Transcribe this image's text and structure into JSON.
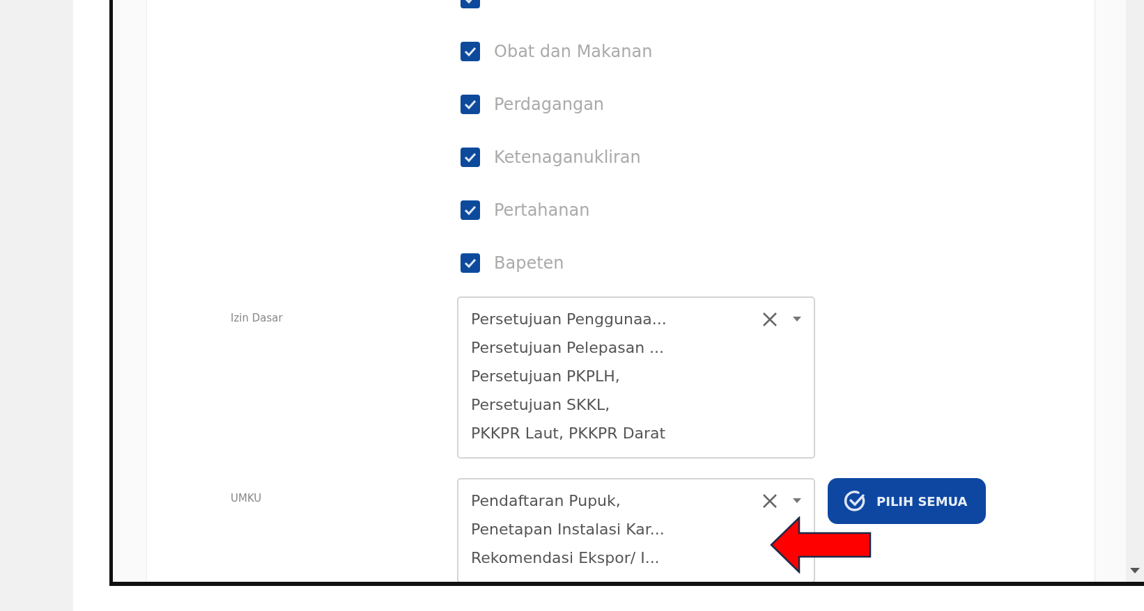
{
  "checkboxes": [
    {
      "checked": true
    },
    {
      "label": "Obat dan Makanan",
      "checked": true
    },
    {
      "label": "Perdagangan",
      "checked": true
    },
    {
      "label": "Ketenaganukliran",
      "checked": true
    },
    {
      "label": "Pertahanan",
      "checked": true
    },
    {
      "label": "Bapeten",
      "checked": true
    }
  ],
  "fields": [
    {
      "label": "Izin Dasar",
      "values": [
        "Persetujuan Penggunaa...",
        "Persetujuan Pelepasan ...",
        "Persetujuan PKPLH,",
        "Persetujuan SKKL,",
        "PKKPR Laut, PKKPR Darat"
      ]
    },
    {
      "label": "UMKU",
      "values": [
        "Pendaftaran Pupuk,",
        "Penetapan Instalasi Kar...",
        "Rekomendasi Ekspor/ I..."
      ],
      "button": "PILIH SEMUA"
    }
  ]
}
